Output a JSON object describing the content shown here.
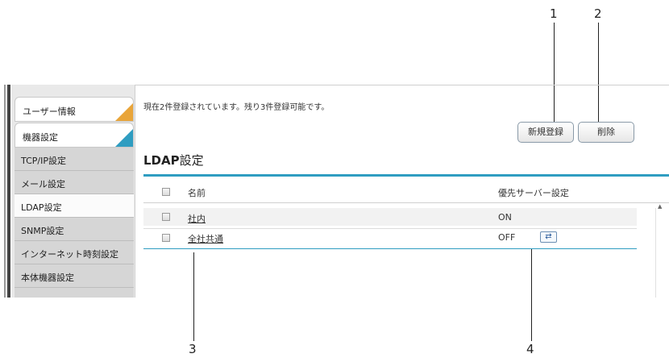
{
  "callouts": [
    "1",
    "2",
    "3",
    "4"
  ],
  "sidebar": {
    "tabs": [
      {
        "label": "ユーザー情報",
        "accent": "#e9a53a"
      },
      {
        "label": "機器設定",
        "accent": "#2f9dc1"
      }
    ],
    "items": [
      {
        "label": "TCP/IP設定"
      },
      {
        "label": "メール設定"
      },
      {
        "label": "LDAP設定"
      },
      {
        "label": "SNMP設定"
      },
      {
        "label": "インターネット時刻設定"
      },
      {
        "label": "本体機器設定"
      }
    ]
  },
  "main": {
    "info": "現在2件登録されています。残り3件登録可能です。",
    "buttons": {
      "new": "新規登録",
      "delete": "削除"
    },
    "title_bold": "LDAP",
    "title_rest": "設定",
    "table": {
      "headers": {
        "name": "名前",
        "priority": "優先サーバー設定"
      },
      "rows": [
        {
          "name": "社内",
          "priority": "ON"
        },
        {
          "name": "全社共通",
          "priority": "OFF"
        }
      ]
    }
  },
  "colors": {
    "accent_blue": "#2f9dc1",
    "accent_orange": "#e9a53a"
  },
  "icons": {
    "priority_swap": "swap-arrows-icon",
    "scroll": "scroll-up-arrow-icon"
  }
}
